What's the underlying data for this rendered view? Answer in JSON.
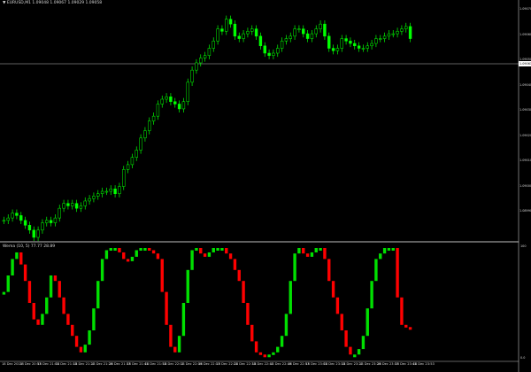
{
  "window": {
    "main_title": "▼ EURUSD,M1  1.09048 1.09067 1.09029 1.09058",
    "indicator_title": "Wema (10, 5)  77.77 28.89",
    "current_price": "1.09061"
  },
  "colors": {
    "background": "#000000",
    "candle": "#00ff00",
    "osc_up": "#00e000",
    "osc_down": "#ff0000",
    "grid": "#c0c0c0"
  },
  "price_axis": {
    "labels": [
      "1.09070",
      "1.09060",
      "1.09050",
      "1.09040",
      "1.09030",
      "1.09020",
      "1.09010",
      "1.09000",
      "1.08990"
    ]
  },
  "indicator_axis": {
    "top_label": "100",
    "bottom_label": "0.0"
  },
  "time_axis": {
    "labels": [
      "18 Dec 2013",
      "18 Dec 20:57",
      "18 Dec 21:05",
      "18 Dec 21:13",
      "18 Dec 21:21",
      "18 Dec 21:29",
      "18 Dec 21:37",
      "18 Dec 21:45",
      "18 Dec 21:53",
      "18 Dec 22:01",
      "18 Dec 22:09",
      "18 Dec 22:17",
      "18 Dec 22:25",
      "18 Dec 22:33",
      "18 Dec 22:41",
      "18 Dec 22:49",
      "18 Dec 22:57",
      "18 Dec 23:05",
      "18 Dec 23:13",
      "18 Dec 23:21",
      "18 Dec 23:29",
      "18 Dec 23:37",
      "18 Dec 23:45",
      "18 Dec 23:53"
    ]
  },
  "chart_data": [
    {
      "type": "candlestick",
      "title": "EURUSD,M1",
      "series": [
        {
          "name": "EURUSD,M1",
          "values": [
            1.08987,
            1.08988,
            1.0899,
            1.08989,
            1.08987,
            1.08985,
            1.08983,
            1.0898,
            1.08983,
            1.08986,
            1.08987,
            1.08986,
            1.08988,
            1.08992,
            1.08994,
            1.08993,
            1.08994,
            1.08992,
            1.08993,
            1.08995,
            1.08996,
            1.08997,
            1.08998,
            1.08999,
            1.08999,
            1.09,
            1.08998,
            1.09001,
            1.09008,
            1.0901,
            1.09013,
            1.09016,
            1.09021,
            1.09024,
            1.09028,
            1.0903,
            1.09035,
            1.09037,
            1.09038,
            1.09036,
            1.09035,
            1.09033,
            1.09036,
            1.09044,
            1.09049,
            1.09052,
            1.09054,
            1.09055,
            1.09058,
            1.09061,
            1.09066,
            1.09065,
            1.0907,
            1.09068,
            1.09063,
            1.09062,
            1.09064,
            1.09065,
            1.09066,
            1.09063,
            1.09059,
            1.09056,
            1.09055,
            1.09056,
            1.09058,
            1.09061,
            1.09062,
            1.09063,
            1.09066,
            1.09066,
            1.09064,
            1.09062,
            1.09064,
            1.09066,
            1.09068,
            1.09063,
            1.09058,
            1.09057,
            1.09058,
            1.09062,
            1.09061,
            1.0906,
            1.09059,
            1.09058,
            1.09058,
            1.09059,
            1.0906,
            1.09062,
            1.09062,
            1.09063,
            1.09064,
            1.09064,
            1.09065,
            1.09066,
            1.09067,
            1.09062
          ]
        }
      ],
      "ylim": [
        1.0898,
        1.09075
      ]
    },
    {
      "type": "bar",
      "title": "Wema (10, 5)",
      "series": [
        {
          "name": "Wema",
          "values": [
            60,
            75,
            90,
            96,
            85,
            70,
            50,
            35,
            30,
            40,
            55,
            75,
            70,
            55,
            40,
            30,
            20,
            10,
            5,
            12,
            25,
            45,
            70,
            90,
            98,
            100,
            100,
            96,
            90,
            88,
            92,
            98,
            100,
            100,
            98,
            95,
            90,
            60,
            30,
            10,
            5,
            20,
            50,
            80,
            98,
            100,
            95,
            92,
            96,
            100,
            100,
            100,
            95,
            90,
            80,
            70,
            50,
            30,
            15,
            5,
            3,
            2,
            3,
            5,
            10,
            20,
            40,
            70,
            95,
            100,
            95,
            92,
            96,
            100,
            100,
            90,
            70,
            55,
            40,
            25,
            10,
            3,
            3,
            8,
            20,
            45,
            70,
            90,
            95,
            100,
            100,
            100,
            55,
            30,
            28,
            26
          ]
        }
      ],
      "colors_by_direction": {
        "up": "#00e000",
        "down": "#ff0000"
      },
      "ylim": [
        0,
        100
      ]
    }
  ]
}
